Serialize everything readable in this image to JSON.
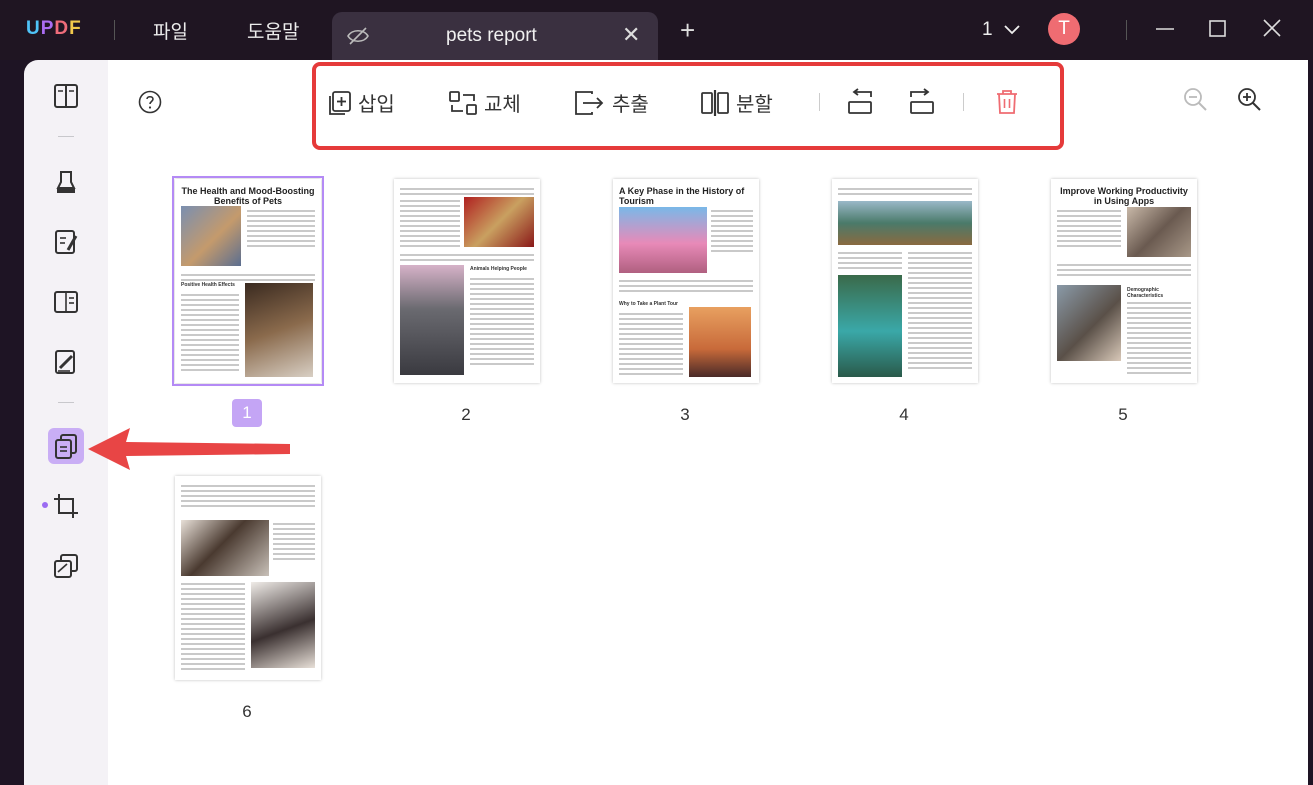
{
  "app": {
    "logo": "UPDF",
    "logo_parts": [
      "U",
      "P",
      "D",
      "F"
    ]
  },
  "menu": {
    "file": "파일",
    "help": "도움말"
  },
  "tab": {
    "title": "pets report",
    "close": "✕",
    "add": "+"
  },
  "window": {
    "page_indicator": "1",
    "user_initial": "T"
  },
  "toolbar": {
    "insert": "삽입",
    "replace": "교체",
    "extract": "추출",
    "split": "분할"
  },
  "colors": {
    "highlight": "#e53a3a",
    "selected": "#b48af5",
    "delete": "#ef6c72"
  },
  "thumbnails": [
    {
      "number": "1",
      "title": "The Health and Mood-Boosting Benefits of Pets",
      "heading": "Positive Health Effects"
    },
    {
      "number": "2",
      "heading": "Animals Helping People"
    },
    {
      "number": "3",
      "title": "A Key Phase in the History of Tourism",
      "heading": "Why to Take a Plant Tour"
    },
    {
      "number": "4"
    },
    {
      "number": "5",
      "title": "Improve Working Productivity in Using Apps",
      "heading": "Demographic Characteristics"
    },
    {
      "number": "6"
    }
  ]
}
